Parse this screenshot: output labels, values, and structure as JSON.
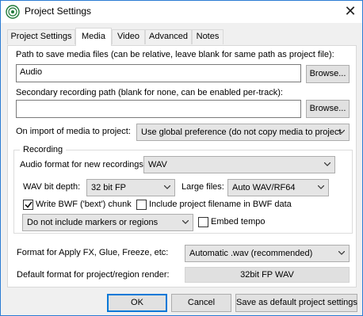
{
  "window": {
    "title": "Project Settings",
    "close_glyph": "✕"
  },
  "tabs": [
    {
      "label": "Project Settings",
      "active": false
    },
    {
      "label": "Media",
      "active": true
    },
    {
      "label": "Video",
      "active": false
    },
    {
      "label": "Advanced",
      "active": false
    },
    {
      "label": "Notes",
      "active": false
    }
  ],
  "media": {
    "path_label": "Path to save media files (can be relative, leave blank for same path as project file):",
    "path_value": "Audio",
    "browse_label": "Browse...",
    "secondary_label": "Secondary recording path (blank for none, can be enabled per-track):",
    "secondary_value": "",
    "browse2_label": "Browse...",
    "import_label": "On import of media to project:",
    "import_value": "Use global preference (do not copy media to project",
    "recording": {
      "group_label": "Recording",
      "format_label": "Audio format for new recordings:",
      "format_value": "WAV",
      "bitdepth_label": "WAV bit depth:",
      "bitdepth_value": "32 bit FP",
      "largefiles_label": "Large files:",
      "largefiles_value": "Auto WAV/RF64",
      "bwf_label": "Write BWF ('bext') chunk",
      "bwf_checked": true,
      "include_filename_label": "Include project filename in BWF data",
      "include_filename_checked": false,
      "markers_value": "Do not include markers or regions",
      "embed_tempo_label": "Embed tempo",
      "embed_tempo_checked": false
    },
    "apply_fx_label": "Format for Apply FX, Glue, Freeze, etc:",
    "apply_fx_value": "Automatic .wav (recommended)",
    "render_label": "Default format for project/region render:",
    "render_value": "32bit FP WAV"
  },
  "footer": {
    "ok_label": "OK",
    "cancel_label": "Cancel",
    "save_default_label": "Save as default project settings"
  },
  "colors": {
    "accent": "#0078d7",
    "window_border": "#2b7cd3",
    "panel_bg": "#ffffff",
    "dialog_bg": "#f0f0f0"
  }
}
